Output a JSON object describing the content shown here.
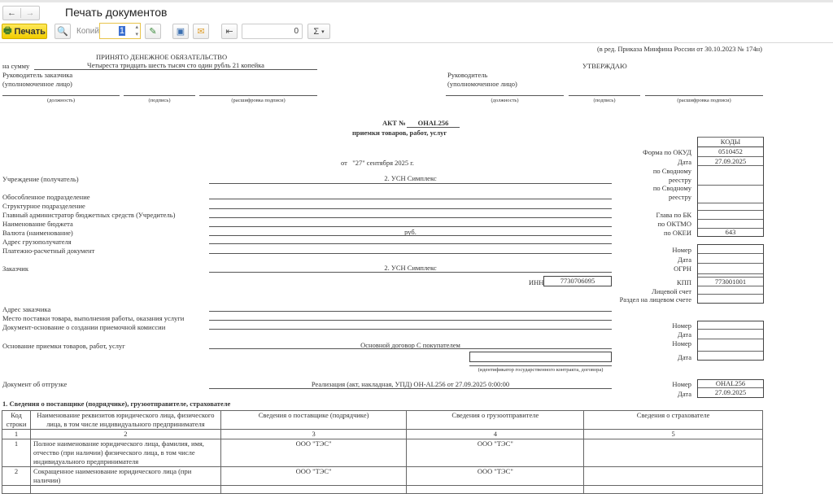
{
  "window": {
    "title": "Печать документов"
  },
  "toolbar": {
    "print_label": "Печать",
    "copies_label": "Копий:",
    "copies_value": "1",
    "sum_value": "0",
    "sigma_label": "Σ"
  },
  "doc": {
    "edition_note": "(в ред. Приказа Минфина России от 30.10.2023 № 174н)",
    "obligation_title": "ПРИНЯТО ДЕНЕЖНОЕ ОБЯЗАТЕЛЬСТВО",
    "sum_label": "на сумму",
    "sum_value": "Четыреста тридцать шесть тысяч сто один рубль 21 копейка",
    "customer_head_label": "Руководитель заказчика",
    "authorized_label": "(уполномоченное лицо)",
    "position_caption": "(должность)",
    "signature_caption": "(подпись)",
    "decode_caption": "(расшифровка подписи)",
    "approve_label": "УТВЕРЖДАЮ",
    "head_label": "Руководитель",
    "act_label": "АКТ №",
    "act_number": "ОНAL256",
    "act_subtitle": "приемки товаров, работ, услуг",
    "date_line": "от   \"27\" сентября 2025 г.",
    "codes": {
      "header": "КОДЫ",
      "okud_label": "Форма по ОКУД",
      "okud": "0510452",
      "date_label": "Дата",
      "date": "27.09.2025",
      "registry_label": "по Сводному реестру",
      "glava_label": "Глава по БК",
      "oktmo_label": "по ОКТМО",
      "okei_label": "по ОКЕИ",
      "okei": "643"
    },
    "fields": {
      "institution": "Учреждение (получатель)",
      "institution_value": "2. УСН Симплекс",
      "separate": "Обособленное подразделение",
      "structural": "Структурное подразделение",
      "admin": "Главный администратор бюджетных средств (Учредитель)",
      "budget": "Наименование бюджета",
      "currency": "Валюта (наименование)",
      "currency_value": "руб.",
      "consignee": "Адрес грузополучателя",
      "payment_doc": "Платежно-расчетный документ",
      "customer": "Заказчик",
      "customer_value": "2. УСН Симплекс",
      "inn_label": "ИНН",
      "inn": "7730706095",
      "customer_address": "Адрес заказчика",
      "delivery_place": "Место поставки товара, выполнения работы, оказания услуги",
      "commission_doc": "Документ-основание о создании приемочной комиссии",
      "basis": "Основание приемки товаров, работ, услуг",
      "basis_value": "Основной договор С покупателем",
      "contract_id_caption": "(идентификатор государственного контракта, договора)",
      "shipment_doc": "Документ об отгрузке",
      "shipment_value": "Реализация (акт, накладная, УПД) ОН-AL256 от 27.09.2025 0:00:00"
    },
    "side": {
      "number_label": "Номер",
      "date_label": "Дата",
      "ogrn_label": "ОГРН",
      "kpp_label": "КПП",
      "kpp": "773001001",
      "account_label": "Лицевой счет",
      "account_section_label": "Раздел на лицевом счете",
      "shipment_number": "ОНAL256",
      "shipment_date": "27.09.2025"
    },
    "section1_title": "1. Сведения о поставщике (подрядчике), грузоотправителе, страхователе",
    "table": {
      "headers": [
        "Код строки",
        "Наименование реквизитов юридического лица, физического лица, в том числе индивидуального предпринимателя",
        "Сведения о поставщике (подрядчике)",
        "Сведения о грузоотправителе",
        "Сведения о страхователе"
      ],
      "numbers": [
        "1",
        "2",
        "3",
        "4",
        "5"
      ],
      "rows": [
        {
          "code": "1",
          "name": "Полное наименование юридического лица, фамилия, имя, отчество (при наличии) физического лица, в том числе индивидуального предпринимателя",
          "supplier": "ООО \"ТЭС\"",
          "shipper": "ООО \"ТЭС\"",
          "insurer": ""
        },
        {
          "code": "2",
          "name": "Сокращенное наименование юридического лица (при наличии)",
          "supplier": "ООО \"ТЭС\"",
          "shipper": "ООО \"ТЭС\"",
          "insurer": ""
        }
      ]
    }
  }
}
